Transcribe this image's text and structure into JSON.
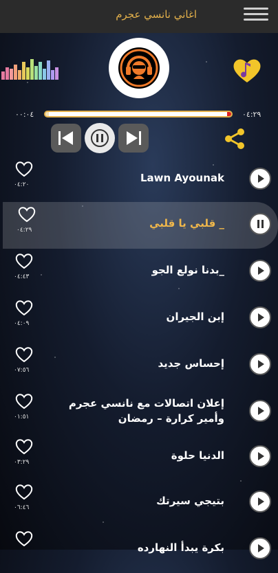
{
  "app": {
    "title": "اغاني نانسي عجرم"
  },
  "player": {
    "elapsed": "٠٠:٠٤",
    "total": "٠٤:٢٩",
    "progress_fraction": 0.02
  },
  "colors": {
    "accent": "#e3b04b",
    "bar_bg": "#2b2b2b",
    "progress_end": "#e02020"
  },
  "icons": {
    "menu": "hamburger-menu-icon",
    "logo": "headphones-dj-icon",
    "favorite": "heart-music-note-icon",
    "share": "share-icon",
    "prev": "skip-previous-icon",
    "pause": "pause-icon",
    "next": "skip-next-icon"
  },
  "songs": [
    {
      "title": "Lawn Ayounak",
      "duration": "٠٤:٢٠",
      "state": "play"
    },
    {
      "title": "_ قلبي يا قلبي",
      "duration": "٠٤:٢٩",
      "state": "pause"
    },
    {
      "title": "_بدنا نولع الجو",
      "duration": "٠٤:٤٣",
      "state": "play"
    },
    {
      "title": "إبن الجيران",
      "duration": "٠٤:٠٩",
      "state": "play"
    },
    {
      "title": "إحساس جديد",
      "duration": "٠٧:٥٦",
      "state": "play"
    },
    {
      "title": "إعلان اتصالات مع نانسي عجرم وأمير كرارة – رمضان",
      "duration": "٠١:٥١",
      "state": "play"
    },
    {
      "title": "الدنيا حلوة",
      "duration": "٠٣:٢٩",
      "state": "play"
    },
    {
      "title": "بتيجي سيرتك",
      "duration": "٠٦:٤٦",
      "state": "play"
    },
    {
      "title": "بكرة يبدأ النهارده",
      "duration": "",
      "state": "play"
    }
  ]
}
